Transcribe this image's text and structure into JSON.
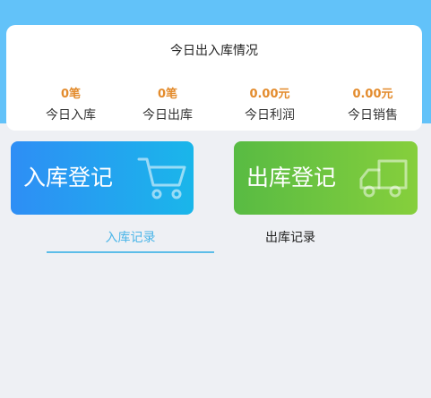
{
  "summary": {
    "title": "今日出入库情况",
    "stats": [
      {
        "value": "0笔",
        "label": "今日入库"
      },
      {
        "value": "0笔",
        "label": "今日出库"
      },
      {
        "value": "0.00元",
        "label": "今日利润"
      },
      {
        "value": "0.00元",
        "label": "今日销售"
      }
    ]
  },
  "actions": {
    "stock_in_label": "入库登记",
    "stock_out_label": "出库登记",
    "stock_in_icon": "cart-icon",
    "stock_out_icon": "truck-icon"
  },
  "tabs": [
    {
      "label": "入库记录",
      "active": true
    },
    {
      "label": "出库记录",
      "active": false
    }
  ],
  "colors": {
    "header_blue": "#62c2f9",
    "stat_orange": "#e38b2c",
    "stock_in_gradient": [
      "#2e8ef5",
      "#1ab6ea"
    ],
    "stock_out_gradient": [
      "#58bb43",
      "#86cf3c"
    ],
    "active_tab": "#4ab5e8"
  }
}
